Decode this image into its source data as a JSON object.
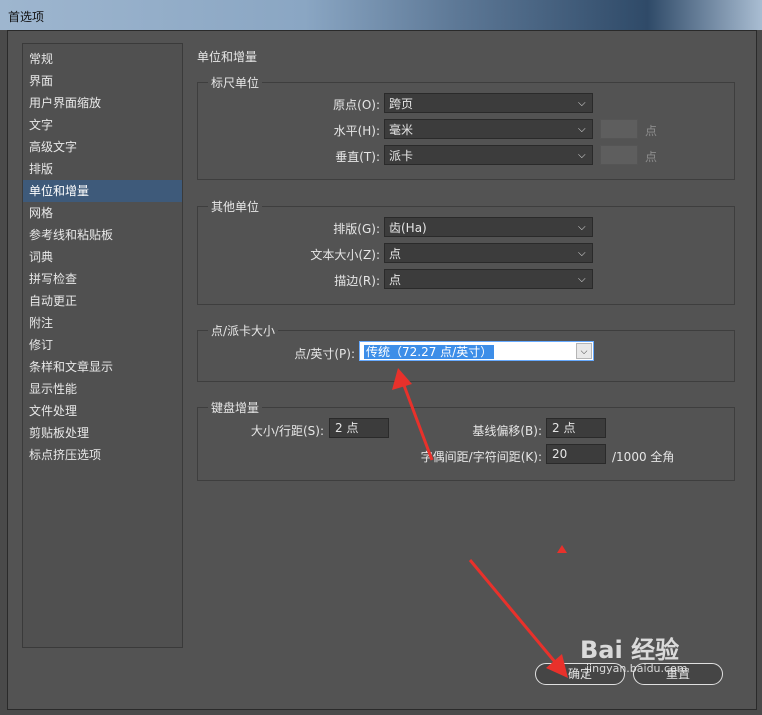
{
  "window": {
    "title": "首选项"
  },
  "sidebar": {
    "items": [
      {
        "label": "常规"
      },
      {
        "label": "界面"
      },
      {
        "label": "用户界面缩放"
      },
      {
        "label": "文字"
      },
      {
        "label": "高级文字"
      },
      {
        "label": "排版"
      },
      {
        "label": "单位和增量",
        "active": true
      },
      {
        "label": "网格"
      },
      {
        "label": "参考线和粘贴板"
      },
      {
        "label": "词典"
      },
      {
        "label": "拼写检查"
      },
      {
        "label": "自动更正"
      },
      {
        "label": "附注"
      },
      {
        "label": "修订"
      },
      {
        "label": "条样和文章显示"
      },
      {
        "label": "显示性能"
      },
      {
        "label": "文件处理"
      },
      {
        "label": "剪贴板处理"
      },
      {
        "label": "标点挤压选项"
      }
    ]
  },
  "main": {
    "title": "单位和增量",
    "ruler": {
      "group_label": "标尺单位",
      "origin_label": "原点(O):",
      "origin_value": "跨页",
      "horizontal_label": "水平(H):",
      "horizontal_value": "毫米",
      "horizontal_unit": "点",
      "vertical_label": "垂直(T):",
      "vertical_value": "派卡",
      "vertical_unit": "点"
    },
    "other": {
      "group_label": "其他单位",
      "composition_label": "排版(G):",
      "composition_value": "齿(Ha)",
      "textsize_label": "文本大小(Z):",
      "textsize_value": "点",
      "stroke_label": "描边(R):",
      "stroke_value": "点"
    },
    "points": {
      "group_label": "点/派卡大小",
      "ppi_label": "点/英寸(P):",
      "ppi_value": "传统（72.27 点/英寸）"
    },
    "keyboard": {
      "group_label": "键盘增量",
      "size_label": "大小/行距(S):",
      "size_value": "2 点",
      "baseline_label": "基线偏移(B):",
      "baseline_value": "2 点",
      "kerning_label": "字偶间距/字符间距(K):",
      "kerning_value": "20",
      "kerning_unit": "/1000 全角"
    }
  },
  "buttons": {
    "ok": "确定",
    "reset": "重置"
  },
  "watermark": {
    "brand": "Bai 经验",
    "url": "jingyan.baidu.com"
  },
  "colors": {
    "annotation_arrow": "#e8312b",
    "selection": "#3d8ee8"
  }
}
